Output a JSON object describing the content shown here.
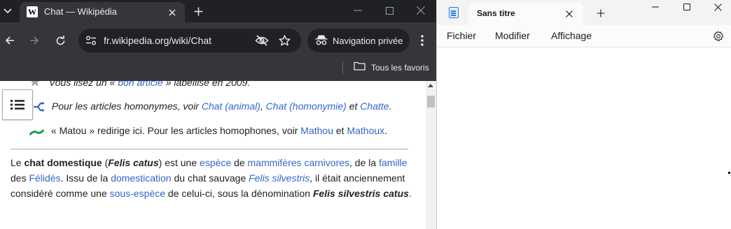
{
  "browser": {
    "tab": {
      "title": "Chat — Wikipédia",
      "favicon": "W"
    },
    "address_bar": {
      "url": "fr.wikipedia.org/wiki/Chat"
    },
    "incognito_label": "Navigation privée",
    "bookmarks_bar": {
      "all_bookmarks": "Tous les favoris"
    },
    "icons": [
      "tab-list-icon",
      "close-icon",
      "new-tab-icon",
      "minimize-icon",
      "maximize-icon",
      "back-icon",
      "forward-icon",
      "reload-icon",
      "site-info-icon",
      "eye-off-icon",
      "star-icon",
      "incognito-icon",
      "more-icon",
      "folder-icon"
    ]
  },
  "article": {
    "hatnote_good": {
      "before": "Vous lisez un « ",
      "link": "bon article",
      "after": " » labellisé en 2009."
    },
    "hatnote_homonyms": {
      "before": "Pour les articles homonymes, voir ",
      "link1": "Chat (animal)",
      "sep1": ", ",
      "link2": "Chat (homonymie)",
      "sep2": " et ",
      "link3": "Chatte",
      "after": "."
    },
    "hatnote_redirect": {
      "before": "« Matou » redirige ici. Pour les articles homophones, voir ",
      "link1": "Mathou",
      "sep": " et ",
      "link2": "Mathoux",
      "after": "."
    },
    "intro": {
      "t1": "Le ",
      "b1": "chat domestique",
      "t2": " (",
      "bi1": "Felis catus",
      "t3": ") est une ",
      "l1": "espèce",
      "t4": " de ",
      "l2": "mammifères carnivores",
      "t5": ", de la ",
      "l3": "famille",
      "t6": " des ",
      "l4": "Félidés",
      "t7": ". Issu de la ",
      "l5": "domestication",
      "t8": " du chat sauvage ",
      "l6": "Felis silvestris",
      "t9": ", il était anciennement considéré comme une ",
      "l7": "sous-espèce",
      "t10": " de celui-ci, sous la dénomination ",
      "bi2": "Felis silvestris catus",
      "t11": "."
    },
    "colors": {
      "link": "#3366cc",
      "text": "#202122"
    }
  },
  "notepad": {
    "tab_title": "Sans titre",
    "menu": {
      "file": "Fichier",
      "edit": "Modifier",
      "view": "Affichage"
    },
    "editor_content": "",
    "icons": [
      "notepad-icon",
      "close-icon",
      "new-tab-icon",
      "minimize-icon",
      "maximize-icon",
      "close-icon",
      "settings-icon"
    ]
  }
}
